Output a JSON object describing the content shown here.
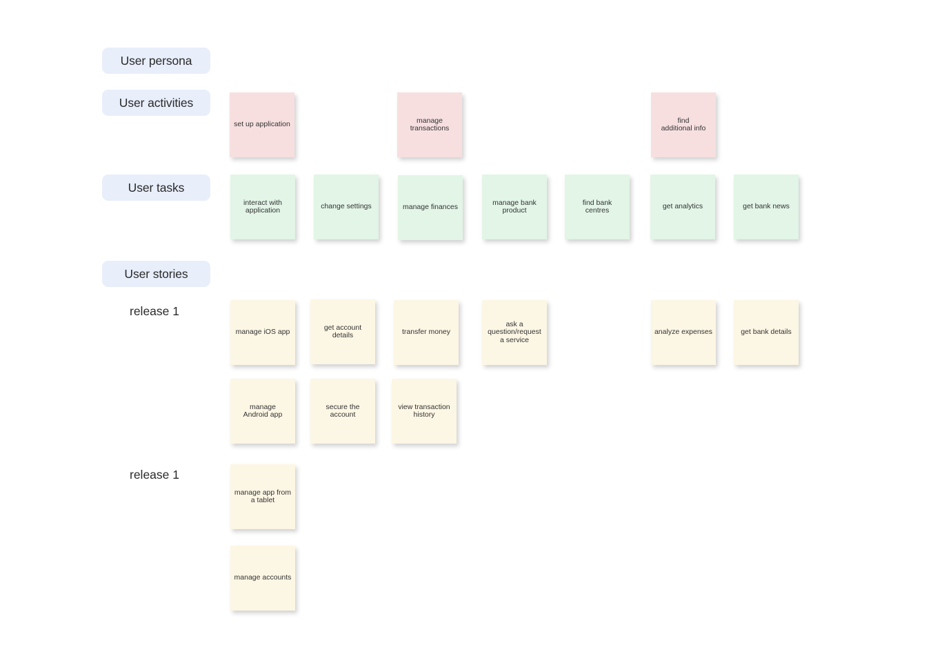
{
  "labels": {
    "persona": "User persona",
    "activities": "User activities",
    "tasks": "User tasks",
    "stories": "User stories",
    "release_a": "release 1",
    "release_b": "release 1"
  },
  "colors": {
    "label_bg": "#e8eefa",
    "activity": "#f7dfe0",
    "task": "#e2f5e7",
    "story": "#fcf6e4"
  },
  "activities": [
    {
      "text": "set up application"
    },
    {
      "text": "manage\ntransactions"
    },
    {
      "text": "find\nadditional info"
    }
  ],
  "tasks": [
    {
      "text": "interact with\napplication"
    },
    {
      "text": "change settings"
    },
    {
      "text": "manage finances"
    },
    {
      "text": "manage bank\nproduct"
    },
    {
      "text": "find bank\ncentres"
    },
    {
      "text": "get analytics"
    },
    {
      "text": "get bank news"
    }
  ],
  "stories_release_a_row1": [
    {
      "text": "manage iOS app"
    },
    {
      "text": "get account\ndetails"
    },
    {
      "text": "transfer money"
    },
    {
      "text": "ask a\nquestion/request\na service"
    },
    {
      "text": "analyze expenses"
    },
    {
      "text": "get bank details"
    }
  ],
  "stories_release_a_row2": [
    {
      "text": "manage\nAndroid app"
    },
    {
      "text": "secure the\naccount"
    },
    {
      "text": "view transaction\nhistory"
    }
  ],
  "stories_release_b": [
    {
      "text": "manage app from\na tablet"
    },
    {
      "text": "manage accounts"
    }
  ]
}
